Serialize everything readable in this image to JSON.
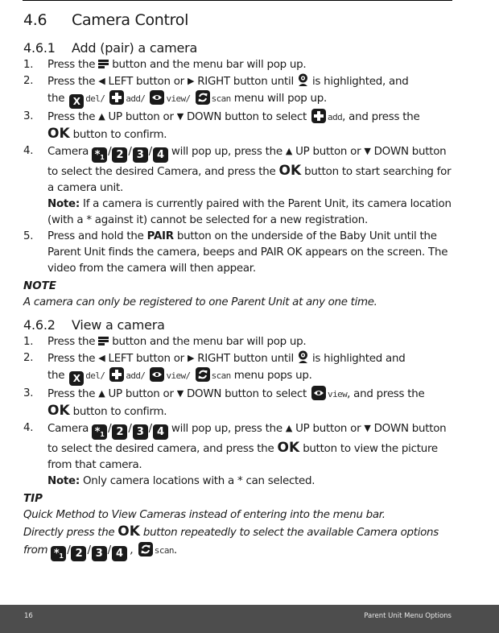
{
  "section": {
    "number": "4.6",
    "title": "Camera Control"
  },
  "icons": {
    "menu": "menu-icon",
    "camera": "camera-icon",
    "left": "◀",
    "right": "▶",
    "up": "▲",
    "down": "▼",
    "ok": "OK",
    "del_tile": "X",
    "add_tile": "+",
    "view_tile": "eye",
    "scan_tile": "refresh",
    "camera_tiles": [
      "*1",
      "2",
      "3",
      "4"
    ]
  },
  "menu_labels": {
    "del": "del/",
    "add": "add/",
    "view": "view/",
    "scan": "scan",
    "add_plain": "add",
    "view_plain": "view"
  },
  "add_camera": {
    "number": "4.6.1",
    "title": "Add (pair) a camera",
    "steps": [
      {
        "n": "1.",
        "a": "Press the",
        "b": "button and the menu bar will pop up."
      },
      {
        "n": "2.",
        "a": "Press the",
        "b": "LEFT button or",
        "c": "RIGHT button until",
        "d": "is highlighted, and",
        "e": "the",
        "f": "menu will pop up."
      },
      {
        "n": "3.",
        "a": "Press the",
        "b": "UP button or",
        "c": "DOWN button to select",
        "d": ", and press the",
        "e": "button to confirm."
      },
      {
        "n": "4.",
        "a": "Camera",
        "b": "will pop up, press the",
        "c": "UP button or",
        "d": "DOWN",
        "e": "button to select the desired Camera, and press the",
        "f": "button to start searching for a camera unit.",
        "note_label": "Note:",
        "note": "If a camera is currently paired with the Parent Unit, its camera location (with a * against it) cannot be selected for a new registration."
      },
      {
        "n": "5.",
        "a": "Press and hold the",
        "bold": "PAIR",
        "b": "button on the underside of the Baby Unit until the Parent Unit finds the camera, beeps and PAIR OK appears on the screen. The video from the camera will then appear."
      }
    ],
    "note_heading": "NOTE",
    "note_text": "A camera can only be registered to one Parent Unit at any one time."
  },
  "view_camera": {
    "number": "4.6.2",
    "title": "View a camera",
    "steps": [
      {
        "n": "1.",
        "a": "Press the",
        "b": "button and the menu bar will pop up."
      },
      {
        "n": "2.",
        "a": "Press the",
        "b": "LEFT button or",
        "c": "RIGHT button until",
        "d": "is highlighted and",
        "e": "the",
        "f": "menu pops up."
      },
      {
        "n": "3.",
        "a": "Press the",
        "b": "UP button or",
        "c": "DOWN button to select",
        "d": ", and press the",
        "e": "button to confirm."
      },
      {
        "n": "4.",
        "a": "Camera",
        "b": "will pop up, press the",
        "c": "UP button or",
        "d": "DOWN",
        "e": "button to select the desired camera, and press the",
        "f": "button to view the picture from that camera.",
        "note_label": "Note:",
        "note": "Only camera locations with a * can selected."
      }
    ],
    "tip_heading": "TIP",
    "tip_line1": "Quick Method to View Cameras instead of entering into the menu bar.",
    "tip_a": "Directly press the",
    "tip_b": "button repeatedly to select the available Camera options from",
    "tip_c": ","
  },
  "footer": {
    "page_number": "16",
    "title": "Parent Unit Menu Options"
  }
}
